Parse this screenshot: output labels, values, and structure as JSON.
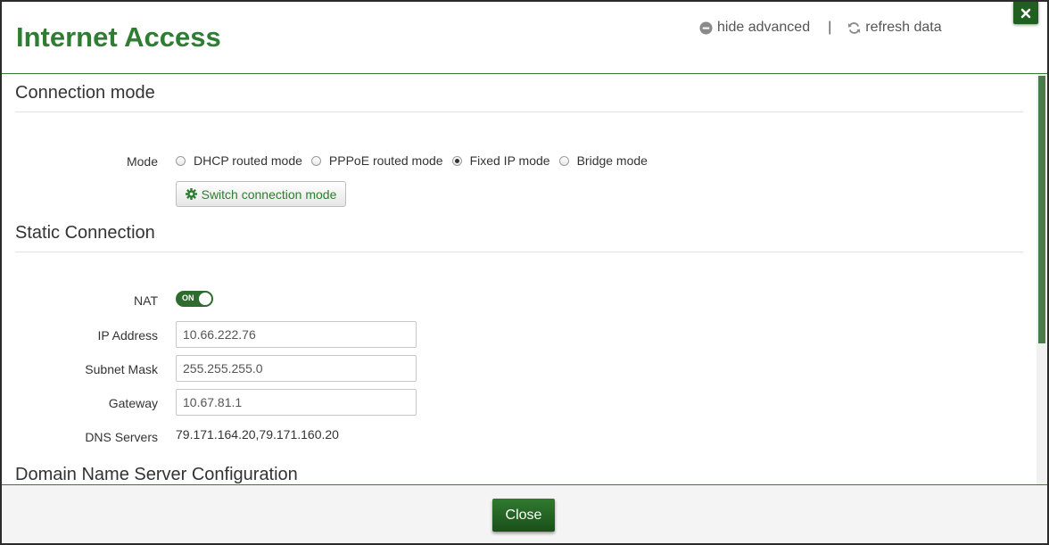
{
  "header": {
    "title": "Internet Access",
    "hide_advanced": "hide advanced",
    "separator": "|",
    "refresh_data": "refresh data",
    "close_icon": "close-icon"
  },
  "connection_mode": {
    "section_title": "Connection mode",
    "mode_label": "Mode",
    "options": [
      {
        "label": "DHCP routed mode",
        "checked": false
      },
      {
        "label": "PPPoE routed mode",
        "checked": false
      },
      {
        "label": "Fixed IP mode",
        "checked": true
      },
      {
        "label": "Bridge mode",
        "checked": false
      }
    ],
    "switch_button": "Switch connection mode"
  },
  "static_connection": {
    "section_title": "Static Connection",
    "nat_label": "NAT",
    "nat_state": "ON",
    "ip_label": "IP Address",
    "ip_value": "10.66.222.76",
    "subnet_label": "Subnet Mask",
    "subnet_value": "255.255.255.0",
    "gateway_label": "Gateway",
    "gateway_value": "10.67.81.1",
    "dns_label": "DNS Servers",
    "dns_value": "79.171.164.20,79.171.160.20"
  },
  "dns_config": {
    "section_title": "Domain Name Server Configuration"
  },
  "footer": {
    "close_button": "Close"
  },
  "colors": {
    "accent": "#2e7d32",
    "dark_green": "#1f5f1f"
  }
}
